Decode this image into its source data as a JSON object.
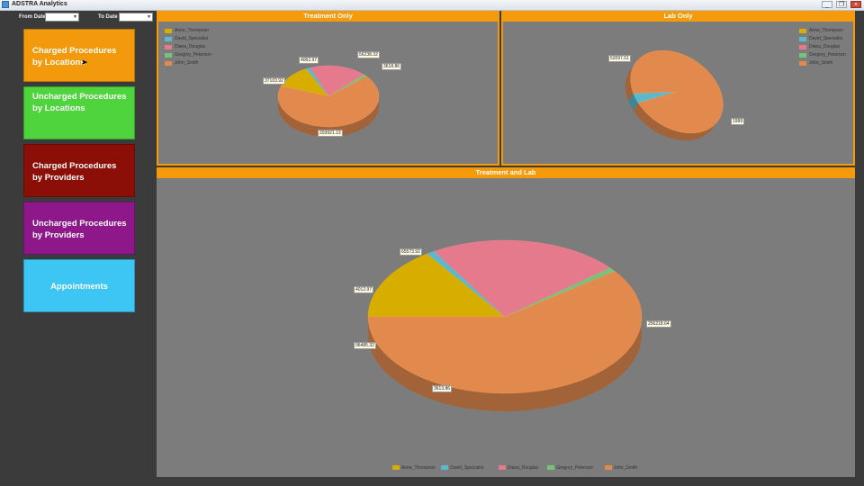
{
  "window": {
    "title": "ADSTRA Analytics",
    "controls": [
      "_",
      "❐",
      "×"
    ]
  },
  "filters": {
    "from_label": "From Date",
    "from_value": "",
    "to_label": "To Date",
    "to_value": ""
  },
  "nav": {
    "charged_locations": "Charged Procedures by Locations",
    "uncharged_locations": "Uncharged Procedures by Locations",
    "charged_providers": "Charged Procedures by Providers",
    "uncharged_providers": "Uncharged Procedures by Providers",
    "appointments": "Appointments"
  },
  "legend_names": [
    "Anne_Thompson",
    "David_Specialist",
    "Diana_Douglas",
    "Gregory_Peterson",
    "John_Smith"
  ],
  "colors": {
    "Anne_Thompson": "#d7ad00",
    "David_Specialist": "#5cb8cc",
    "Diana_Douglas": "#e57a8c",
    "Gregory_Peterson": "#77c27a",
    "John_Smith": "#e28a4e",
    "panel_header": "#f59a0a"
  },
  "chart_data": [
    {
      "type": "pie",
      "title": "Treatment Only",
      "legend_position": "top-left",
      "series": [
        {
          "name": "Anne_Thompson",
          "value": 37103.92,
          "label": "37103.92"
        },
        {
          "name": "David_Specialist",
          "value": 4062.97,
          "label": "4062.97"
        },
        {
          "name": "Diana_Douglas",
          "value": 56238.32,
          "label": "56238.32"
        },
        {
          "name": "Gregory_Peterson",
          "value": 3618.86,
          "label": "3618.86"
        },
        {
          "name": "John_Smith",
          "value": 203921.13,
          "label": "203921.13"
        }
      ]
    },
    {
      "type": "pie",
      "title": "Lab Only",
      "legend_position": "top-right",
      "series": [
        {
          "name": "Anne_Thompson",
          "value": 0,
          "label": ""
        },
        {
          "name": "David_Specialist",
          "value": 1999,
          "label": "1999"
        },
        {
          "name": "Diana_Douglas",
          "value": 0,
          "label": ""
        },
        {
          "name": "Gregory_Peterson",
          "value": 0,
          "label": ""
        },
        {
          "name": "John_Smith",
          "value": 52097.51,
          "label": "52097.51"
        }
      ]
    },
    {
      "type": "pie",
      "title": "Treatment and Lab",
      "legend_position": "bottom",
      "series": [
        {
          "name": "Anne_Thompson",
          "value": 65573.92,
          "label": "65573.92"
        },
        {
          "name": "David_Specialist",
          "value": 4012.97,
          "label": "4012.97"
        },
        {
          "name": "Diana_Douglas",
          "value": 96485.32,
          "label": "96485.32"
        },
        {
          "name": "Gregory_Peterson",
          "value": 3613.86,
          "label": "3613.86"
        },
        {
          "name": "John_Smith",
          "value": 256218.64,
          "label": "256218.64"
        }
      ]
    }
  ]
}
